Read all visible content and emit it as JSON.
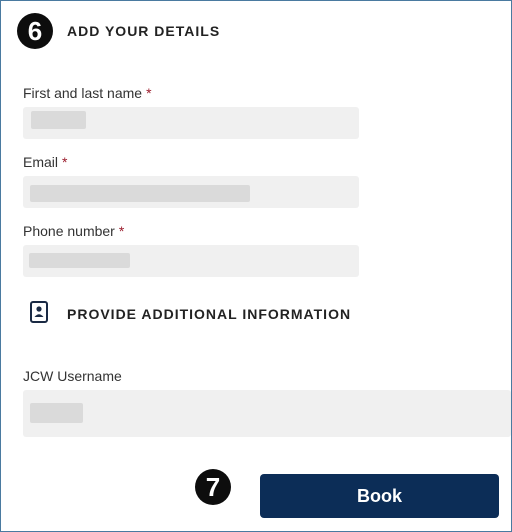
{
  "steps": {
    "details_number": "6",
    "book_number": "7"
  },
  "details": {
    "title": "ADD YOUR DETAILS",
    "fields": [
      {
        "label": "First and last name",
        "required_mark": "*"
      },
      {
        "label": "Email",
        "required_mark": "*"
      },
      {
        "label": "Phone number",
        "required_mark": "*"
      }
    ]
  },
  "additional": {
    "icon": "id-card-icon",
    "title": "PROVIDE ADDITIONAL INFORMATION",
    "username_label": "JCW Username"
  },
  "actions": {
    "book_label": "Book"
  },
  "colors": {
    "button": "#0c2d57",
    "required": "#9b1c2c",
    "input_bg": "#f0f0f0"
  }
}
